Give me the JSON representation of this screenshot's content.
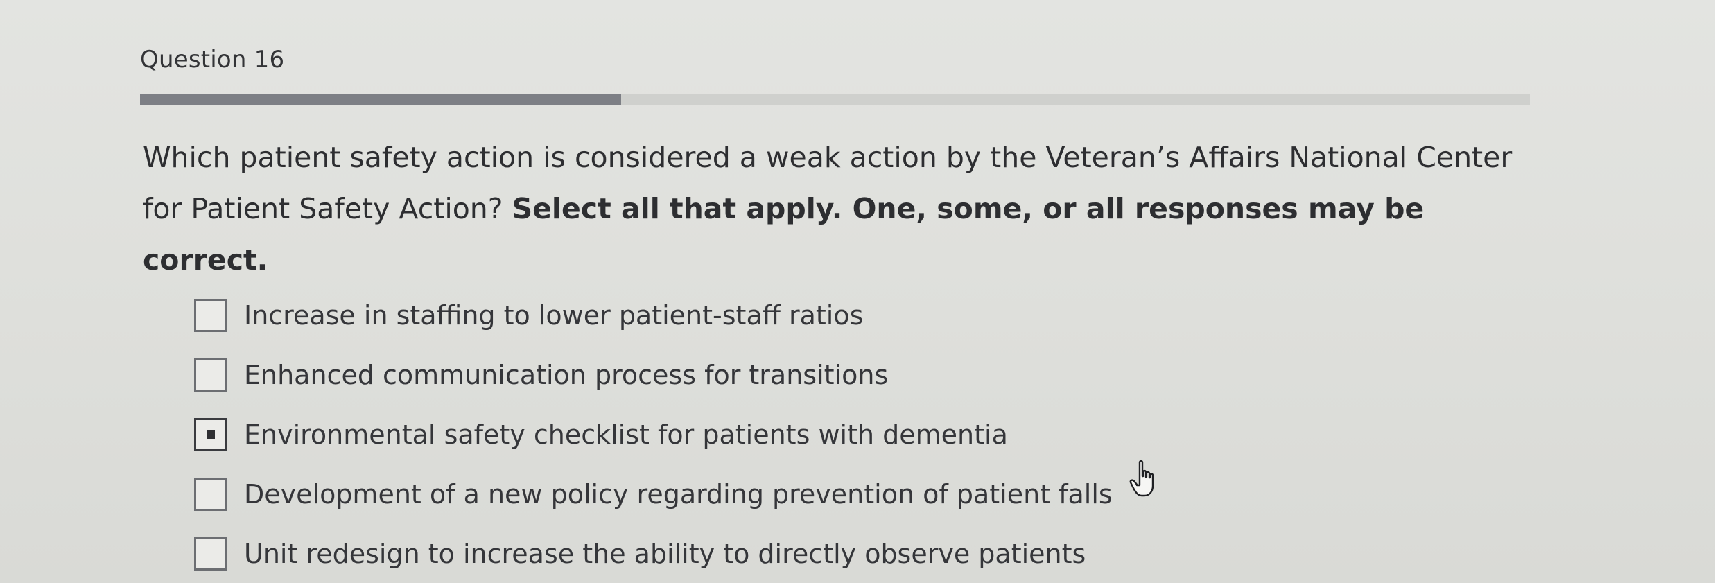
{
  "question": {
    "label": "Question 16",
    "progress_fraction": 0.346,
    "text_normal": "Which patient safety action is considered a weak action by the Veteran’s Affairs National Center for Patient Safety Action? ",
    "text_emphasis": "Select all that apply. One, some, or all responses may be correct."
  },
  "options": [
    {
      "label": "Increase in staffing to lower patient-staff ratios",
      "checked": false
    },
    {
      "label": "Enhanced communication process for transitions",
      "checked": false
    },
    {
      "label": "Environmental safety checklist for patients with dementia",
      "checked": true
    },
    {
      "label": "Development of a new policy regarding prevention of patient falls",
      "checked": false
    },
    {
      "label": "Unit redesign to increase the ability to directly observe patients",
      "checked": false
    }
  ],
  "cursor": {
    "icon": "hand-pointer-icon"
  }
}
